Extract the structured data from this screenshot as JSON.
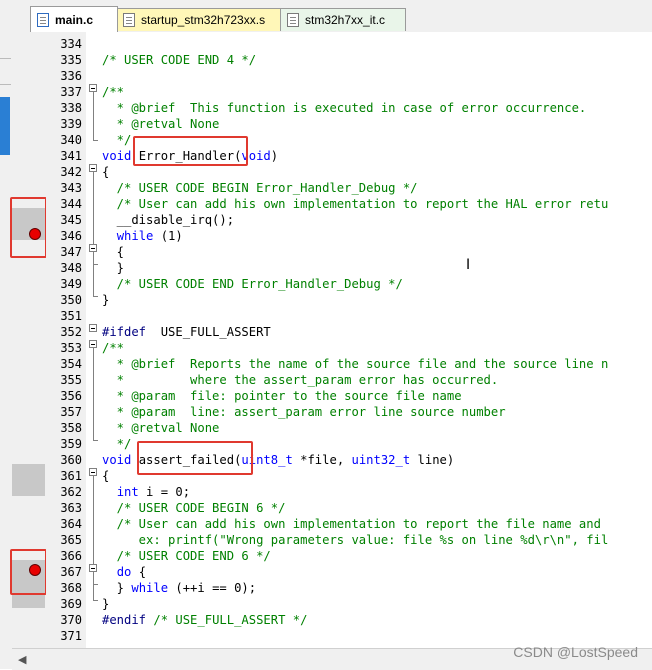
{
  "tabs": [
    {
      "label": "main.c",
      "active": true
    },
    {
      "label": "startup_stm32h723xx.s",
      "active": false
    },
    {
      "label": "stm32h7xx_it.c",
      "active": false
    }
  ],
  "lines": [
    {
      "no": "334",
      "text": ""
    },
    {
      "no": "335",
      "text": "/* USER CODE END 4 */"
    },
    {
      "no": "336",
      "text": ""
    },
    {
      "no": "337",
      "text": "/**"
    },
    {
      "no": "338",
      "text": "  * @brief  This function is executed in case of error occurrence."
    },
    {
      "no": "339",
      "text": "  * @retval None"
    },
    {
      "no": "340",
      "text": "  */"
    },
    {
      "no": "341",
      "text": "void Error_Handler(void)"
    },
    {
      "no": "342",
      "text": "{"
    },
    {
      "no": "343",
      "text": "  /* USER CODE BEGIN Error_Handler_Debug */"
    },
    {
      "no": "344",
      "text": "  /* User can add his own implementation to report the HAL error retu"
    },
    {
      "no": "345",
      "text": "  __disable_irq();"
    },
    {
      "no": "346",
      "text": "  while (1)"
    },
    {
      "no": "347",
      "text": "  {"
    },
    {
      "no": "348",
      "text": "  }"
    },
    {
      "no": "349",
      "text": "  /* USER CODE END Error_Handler_Debug */"
    },
    {
      "no": "350",
      "text": "}"
    },
    {
      "no": "351",
      "text": ""
    },
    {
      "no": "352",
      "text": "#ifdef  USE_FULL_ASSERT"
    },
    {
      "no": "353",
      "text": "/**"
    },
    {
      "no": "354",
      "text": "  * @brief  Reports the name of the source file and the source line n"
    },
    {
      "no": "355",
      "text": "  *         where the assert_param error has occurred."
    },
    {
      "no": "356",
      "text": "  * @param  file: pointer to the source file name"
    },
    {
      "no": "357",
      "text": "  * @param  line: assert_param error line source number"
    },
    {
      "no": "358",
      "text": "  * @retval None"
    },
    {
      "no": "359",
      "text": "  */"
    },
    {
      "no": "360",
      "text": "void assert_failed(uint8_t *file, uint32_t line)"
    },
    {
      "no": "361",
      "text": "{"
    },
    {
      "no": "362",
      "text": "  int i = 0;"
    },
    {
      "no": "363",
      "text": "  /* USER CODE BEGIN 6 */"
    },
    {
      "no": "364",
      "text": "  /* User can add his own implementation to report the file name and"
    },
    {
      "no": "365",
      "text": "     ex: printf(\"Wrong parameters value: file %s on line %d\\r\\n\", fil"
    },
    {
      "no": "366",
      "text": "  /* USER CODE END 6 */"
    },
    {
      "no": "367",
      "text": "  do {"
    },
    {
      "no": "368",
      "text": "  } while (++i == 0);"
    },
    {
      "no": "369",
      "text": "}"
    },
    {
      "no": "370",
      "text": "#endif /* USE_FULL_ASSERT */"
    },
    {
      "no": "371",
      "text": ""
    }
  ],
  "watermark": "CSDN @LostSpeed",
  "colors": {
    "comment": "#008000",
    "keyword": "#0000ff",
    "highlight": "#e0392f",
    "breakpoint": "#e80000"
  }
}
